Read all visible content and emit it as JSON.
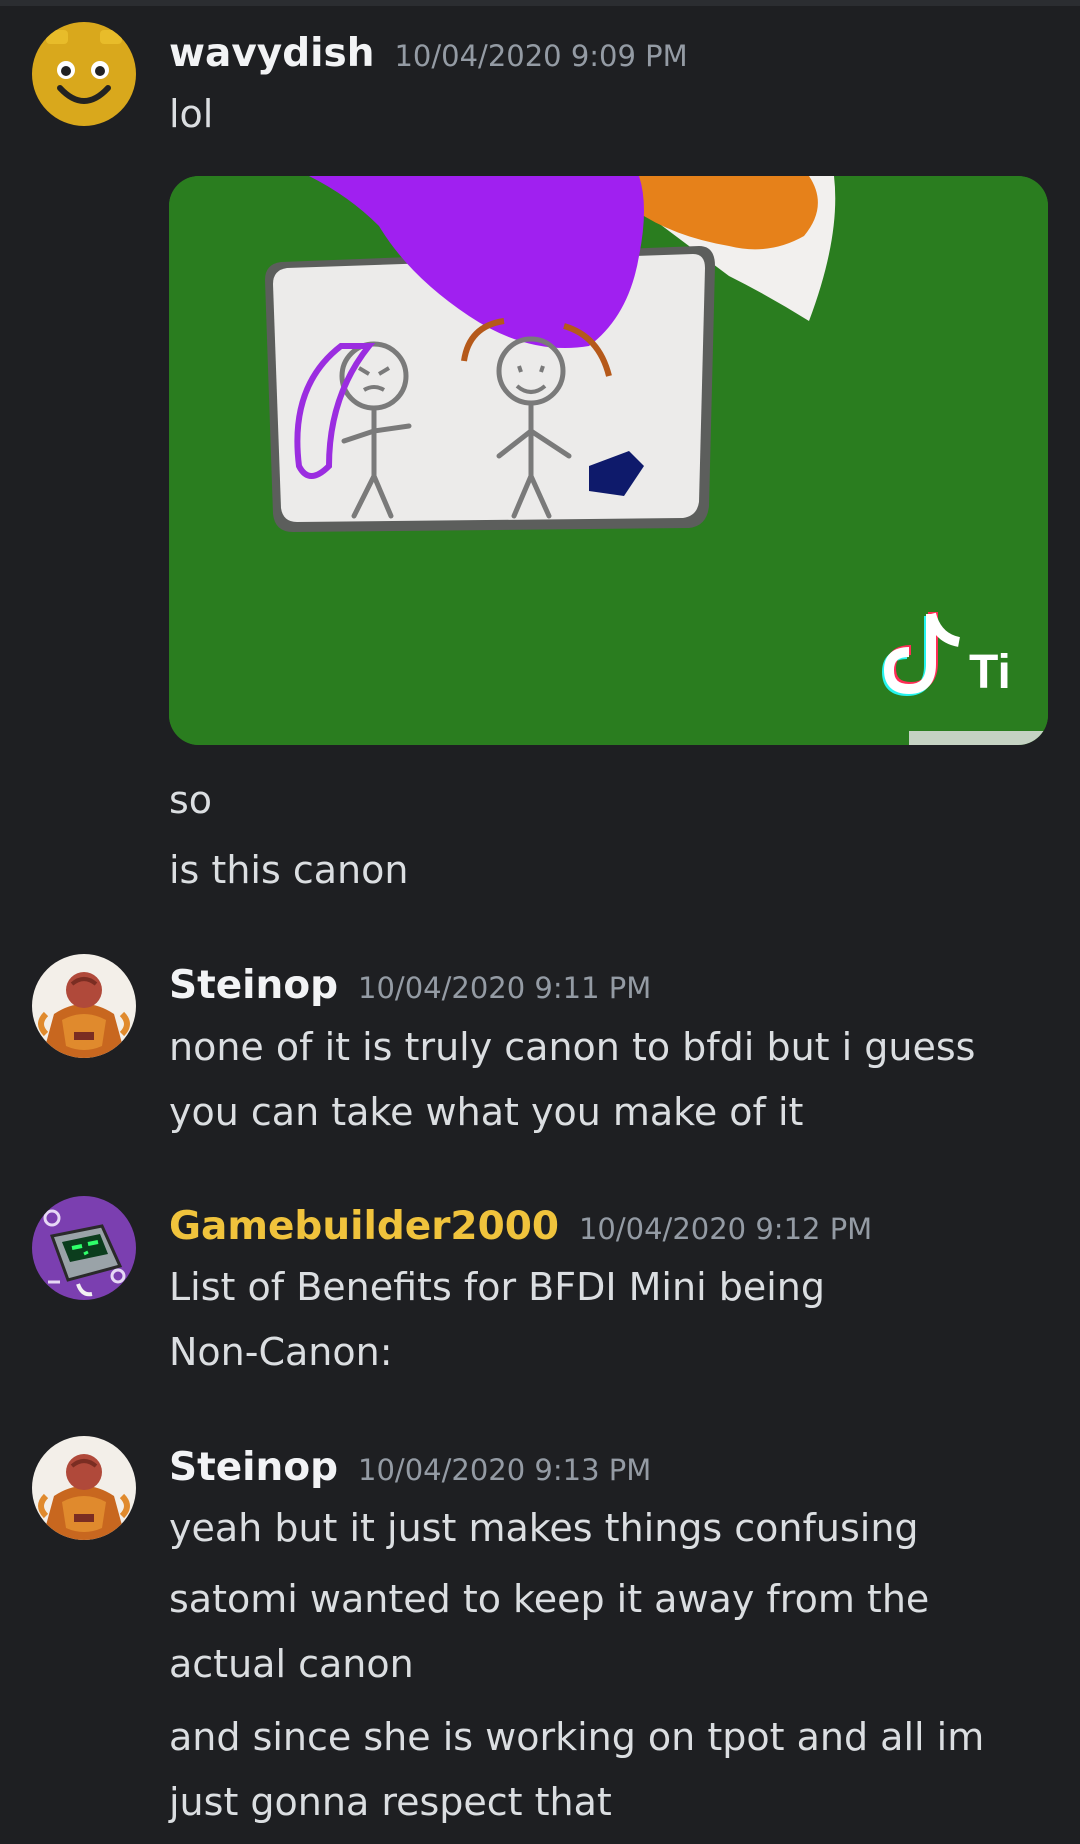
{
  "messages": [
    {
      "author": "wavydish",
      "timestamp": "10/04/2020 9:09 PM",
      "lines": [
        "lol"
      ],
      "attachment": {
        "type": "video-thumbnail",
        "watermark": "Ti",
        "watermark_icon": "tiktok-icon"
      },
      "followups": [
        "so",
        "is this canon"
      ],
      "avatar_icon": "smiley-block-avatar"
    },
    {
      "author": "Steinop",
      "timestamp": "10/04/2020 9:11 PM",
      "lines": [
        "none of it is truly canon to bfdi but i guess",
        "you can take what you make of it"
      ],
      "avatar_icon": "robed-figure-avatar"
    },
    {
      "author": "Gamebuilder2000",
      "author_color": "#f0c33c",
      "timestamp": "10/04/2020 9:12 PM",
      "lines": [
        "List of Benefits for BFDI Mini being",
        "Non-Canon:"
      ],
      "avatar_icon": "robot-character-avatar"
    },
    {
      "author": "Steinop",
      "timestamp": "10/04/2020 9:13 PM",
      "lines": [
        "yeah but it just makes things confusing",
        "satomi wanted to keep it away from the",
        "actual canon",
        "and since she is working on tpot and all im",
        "just gonna respect that"
      ],
      "avatar_icon": "robed-figure-avatar"
    }
  ],
  "colors": {
    "background": "#1e1f22",
    "username": "#f2f3f5",
    "username_gold": "#f0c33c",
    "timestamp": "#949ba4",
    "text": "#dbdee1"
  }
}
